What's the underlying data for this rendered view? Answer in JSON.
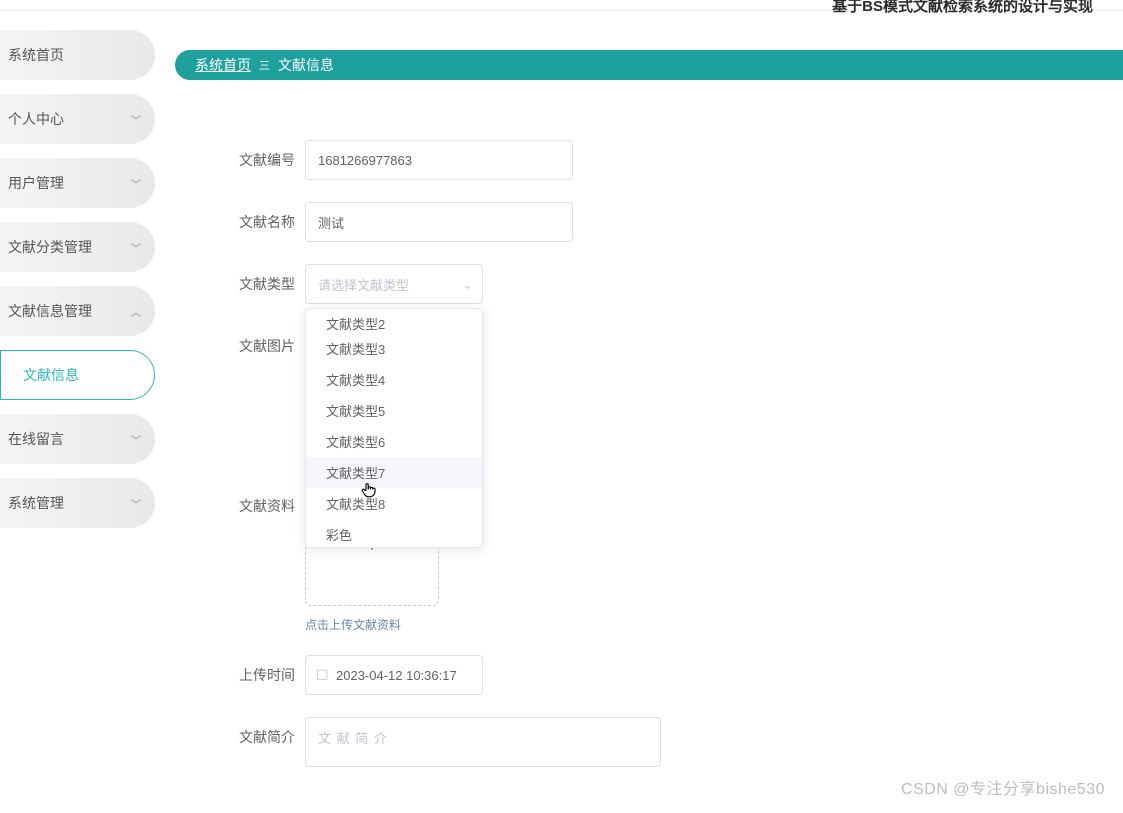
{
  "header": {
    "title": "基于BS模式文献检索系统的设计与实现"
  },
  "sidebar": {
    "items": [
      {
        "label": "系统首页",
        "expandable": false
      },
      {
        "label": "个人中心",
        "expandable": true
      },
      {
        "label": "用户管理",
        "expandable": true
      },
      {
        "label": "文献分类管理",
        "expandable": true
      },
      {
        "label": "文献信息管理",
        "expandable": true
      },
      {
        "label": "文献信息",
        "sub": true
      },
      {
        "label": "在线留言",
        "expandable": true
      },
      {
        "label": "系统管理",
        "expandable": true
      }
    ]
  },
  "breadcrumb": {
    "home": "系统首页",
    "sep": "三",
    "current": "文献信息"
  },
  "form": {
    "doc_no": {
      "label": "文献编号",
      "value": "1681266977863"
    },
    "doc_name": {
      "label": "文献名称",
      "value": "测试"
    },
    "doc_type": {
      "label": "文献类型",
      "placeholder": "请选择文献类型"
    },
    "doc_image": {
      "label": "文献图片"
    },
    "doc_file": {
      "label": "文献资料",
      "hint": "点击上传文献资料"
    },
    "upload_time": {
      "label": "上传时间",
      "value": "2023-04-12 10:36:17"
    },
    "doc_brief": {
      "label": "文献简介",
      "placeholder": "文 献 简 介"
    }
  },
  "dropdown": {
    "options": [
      "文献类型2",
      "文献类型3",
      "文献类型4",
      "文献类型5",
      "文献类型6",
      "文献类型7",
      "文献类型8",
      "彩色"
    ],
    "hover_index": 5
  },
  "watermark": "CSDN @专注分享bishe530"
}
